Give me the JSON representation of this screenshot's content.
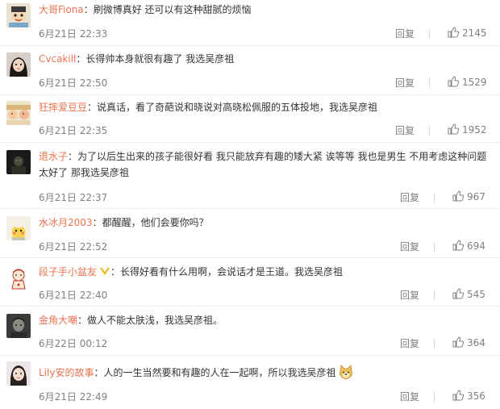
{
  "colors": {
    "username": "#eb7350",
    "meta": "#808080",
    "text": "#333333"
  },
  "comments": [
    {
      "username": "大哥Fiona",
      "separator": "：",
      "text": "刷微博真好 还可以有这种甜腻的烦恼",
      "time": "6月21日 22:33",
      "reply": "回复",
      "likes": "2145"
    },
    {
      "username": "Cvcakill",
      "separator": "：",
      "text": "长得帅本身就很有趣了 我选吴彦祖",
      "time": "6月21日 22:50",
      "reply": "回复",
      "likes": "1529"
    },
    {
      "username": "狂摔爱豆豆",
      "separator": "：",
      "text": "说真话，看了奇葩说和晓说对高晓松佩服的五体投地，我选吴彦祖",
      "time": "6月21日 22:35",
      "reply": "回复",
      "likes": "1952"
    },
    {
      "username": "退水子",
      "separator": "：",
      "text": "为了以后生出来的孩子能很好看 我只能放弃有趣的矮大紧 诶等等 我也是男生 不用考虑这种问题",
      "text2": "太好了 那我选吴彦祖",
      "time": "6月21日 22:37",
      "reply": "回复",
      "likes": "967"
    },
    {
      "username": "水冰月2003",
      "separator": "：",
      "text": "都醒醒，他们会要你吗？",
      "time": "6月21日 22:52",
      "reply": "回复",
      "likes": "694"
    },
    {
      "username": "段子手小盆友",
      "separator": "：",
      "text": "长得好看有什么用啊，会说话才是王道。我选吴彦祖",
      "time": "6月21日 22:40",
      "reply": "回复",
      "likes": "545"
    },
    {
      "username": "金角大嘲",
      "separator": "：",
      "text": "做人不能太肤浅，我选吴彦祖。",
      "time": "6月22日 00:12",
      "reply": "回复",
      "likes": "364"
    },
    {
      "username": "Lily安的故事",
      "separator": "：",
      "text": "人的一生当然要和有趣的人在一起啊，所以我选吴彦祖",
      "time": "6月21日 22:49",
      "reply": "回复",
      "likes": "356"
    }
  ]
}
